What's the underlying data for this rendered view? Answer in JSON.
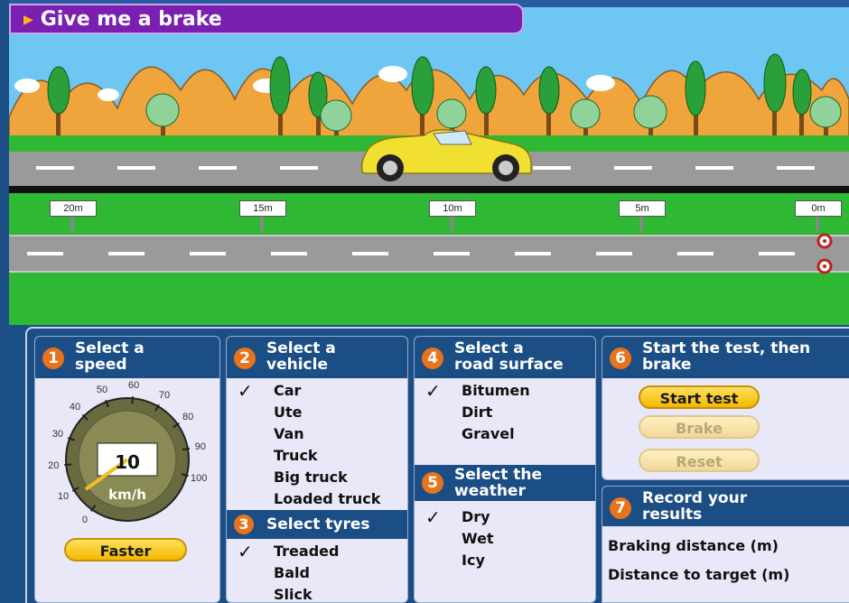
{
  "app": {
    "title": "Give me a brake"
  },
  "scene": {
    "distance_markers": [
      "20m",
      "15m",
      "10m",
      "5m",
      "0m"
    ]
  },
  "steps": {
    "speed": {
      "number": "1",
      "heading_line1": "Select a",
      "heading_line2": "speed",
      "dial_ticks": [
        "0",
        "10",
        "20",
        "30",
        "40",
        "50",
        "60",
        "70",
        "80",
        "90",
        "100"
      ],
      "current_speed": "10",
      "unit": "km/h",
      "faster_label": "Faster"
    },
    "vehicle": {
      "number": "2",
      "heading_line1": "Select a",
      "heading_line2": "vehicle",
      "options": [
        "Car",
        "Ute",
        "Van",
        "Truck",
        "Big truck",
        "Loaded truck"
      ],
      "selected": "Car"
    },
    "tyres": {
      "number": "3",
      "heading": "Select tyres",
      "options": [
        "Treaded",
        "Bald",
        "Slick"
      ],
      "selected": "Treaded"
    },
    "surface": {
      "number": "4",
      "heading_line1": "Select a",
      "heading_line2": "road surface",
      "options": [
        "Bitumen",
        "Dirt",
        "Gravel"
      ],
      "selected": "Bitumen"
    },
    "weather": {
      "number": "5",
      "heading_line1": "Select the",
      "heading_line2": "weather",
      "options": [
        "Dry",
        "Wet",
        "Icy"
      ],
      "selected": "Dry"
    },
    "test": {
      "number": "6",
      "heading_line1": "Start the test, then",
      "heading_line2": "brake",
      "start_label": "Start test",
      "brake_label": "Brake",
      "reset_label": "Reset"
    },
    "results": {
      "number": "7",
      "heading_line1": "Record your",
      "heading_line2": "results",
      "braking_distance_label": "Braking distance (m)",
      "distance_to_target_label": "Distance to target (m)"
    }
  },
  "colors": {
    "panel_header": "#1c4e86",
    "step_badge": "#e8731a",
    "title_bar": "#7a1fb0",
    "button_active": "#f4b800",
    "sky": "#6ec6f2",
    "grass": "#2fb833"
  }
}
